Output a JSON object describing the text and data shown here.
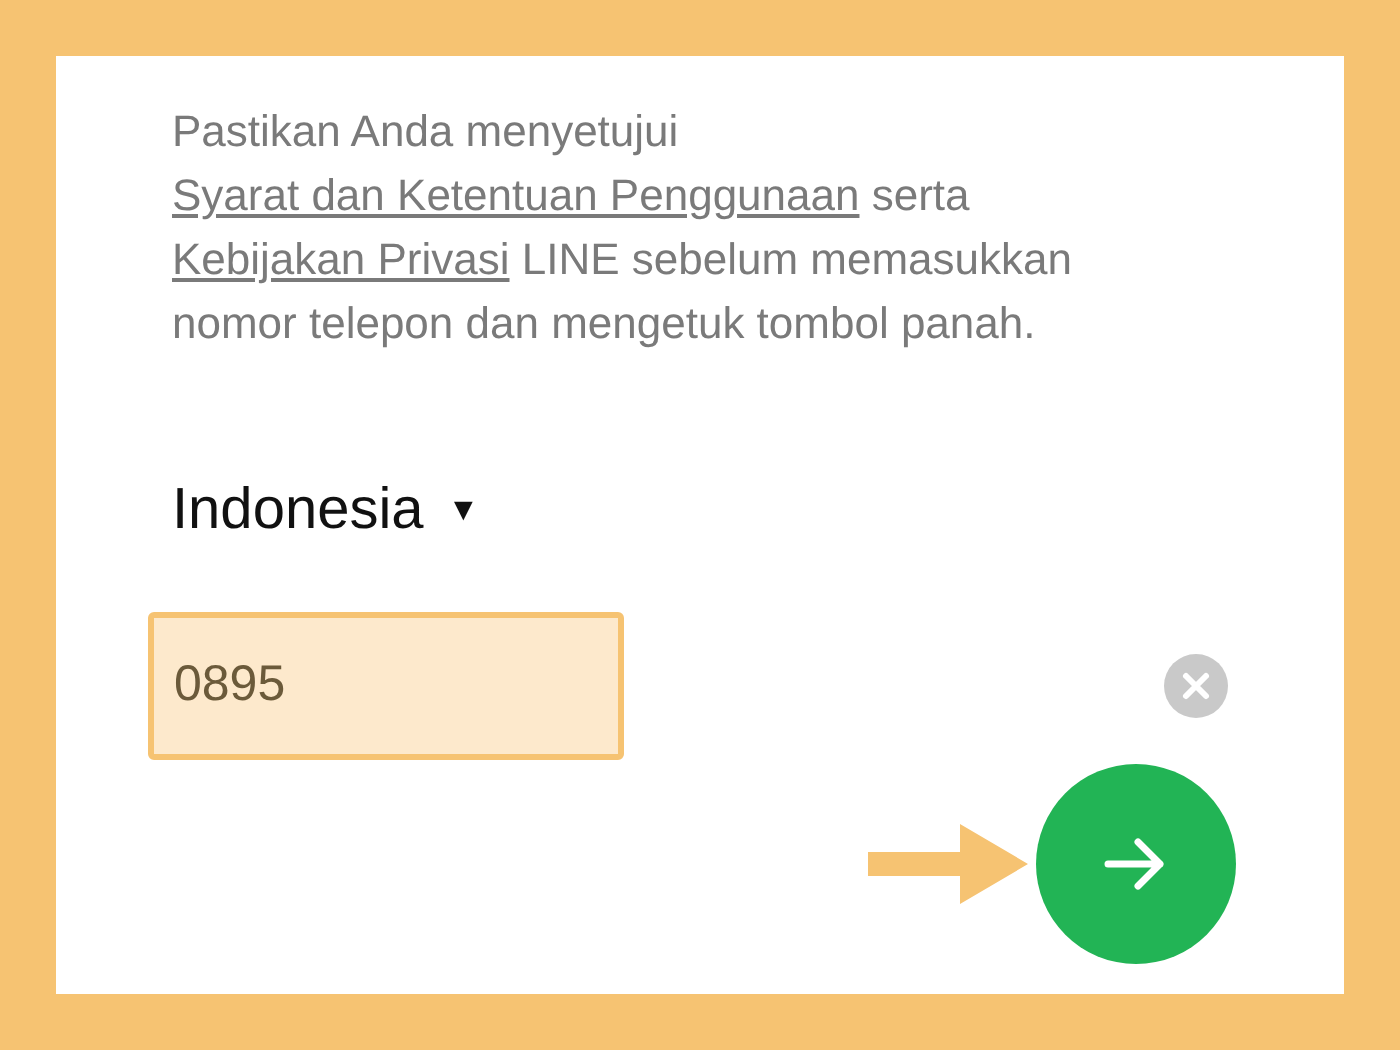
{
  "notice": [
    {
      "kind": "text",
      "text": "Pastikan Anda menyetujui "
    },
    {
      "kind": "link",
      "text": "Syarat dan Ketentuan Penggunaan"
    },
    {
      "kind": "text",
      "text": " serta "
    },
    {
      "kind": "link",
      "text": "Kebijakan Privasi"
    },
    {
      "kind": "text",
      "text": " LINE sebelum memasukkan nomor telepon dan mengetuk tombol panah."
    }
  ],
  "country": {
    "label": "Indonesia",
    "caret": "▼"
  },
  "phone": {
    "value": "0895",
    "highlighted": true
  },
  "next_button": {
    "pointer": true
  }
}
